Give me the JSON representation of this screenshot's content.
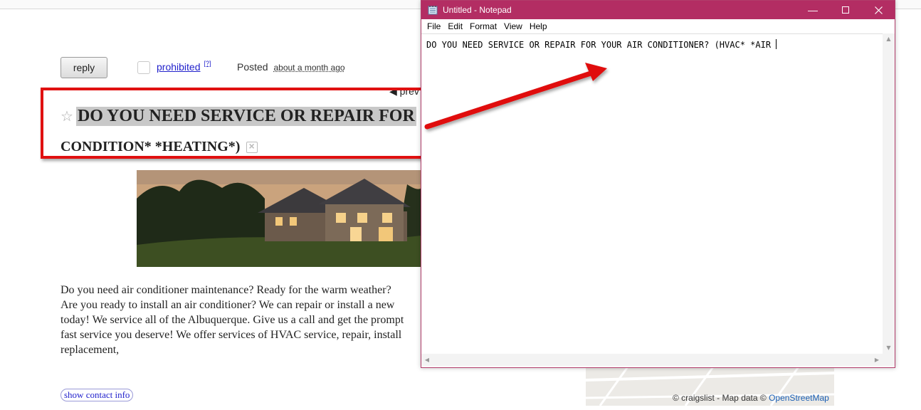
{
  "page": {
    "reply_label": "reply",
    "prohibited_label": "prohibited",
    "prohibited_count": "[?]",
    "posted_label": "Posted",
    "posted_ago": "about a month ago",
    "prev_label": "◀ prev",
    "title_line1": "DO YOU NEED SERVICE OR REPAIR FOR",
    "title_line2": "CONDITION* *HEATING*)",
    "body_lines": [
      "Do you need air conditioner maintenance? Ready for the warm weather?",
      "Are you ready to install an air conditioner? We can repair or install a new",
      "today! We service all of the Albuquerque. Give us a call and get the prompt",
      "fast service you deserve! We offer services of HVAC service, repair, install",
      "replacement,"
    ],
    "contact_label": "show contact info",
    "map_credit": "© craigslist - Map data ©",
    "map_osm": "OpenStreetMap"
  },
  "notepad": {
    "title": "Untitled - Notepad",
    "menu": [
      "File",
      "Edit",
      "Format",
      "View",
      "Help"
    ],
    "content": "DO YOU NEED SERVICE OR REPAIR FOR YOUR AIR CONDITIONER? (HVAC* *AIR "
  },
  "colors": {
    "title_bar": "#b32d63",
    "highlight_box": "#e01010",
    "link": "#2222cc"
  }
}
